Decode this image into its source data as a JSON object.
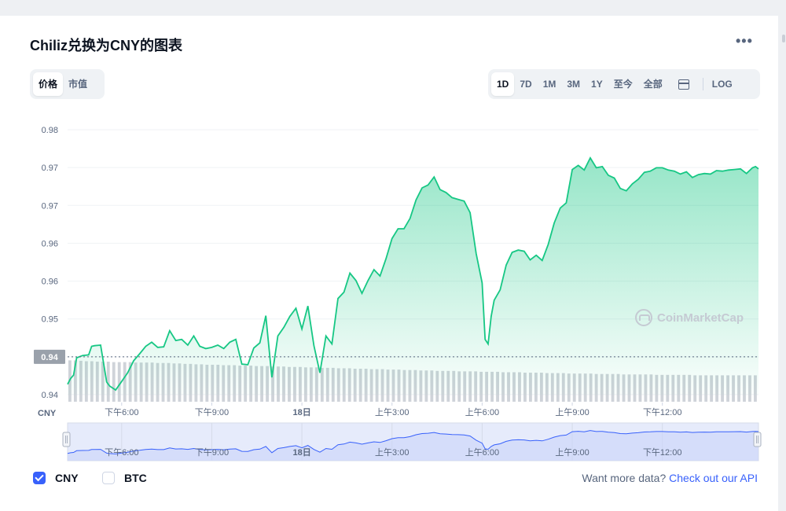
{
  "title": "Chiliz兑换为CNY的图表",
  "more_icon": "more-horizontal-icon",
  "left_toggle": {
    "items": [
      "价格",
      "市值"
    ],
    "selected": "价格"
  },
  "range_toggle": {
    "items": [
      "1D",
      "7D",
      "1M",
      "3M",
      "1Y",
      "至今",
      "全部"
    ],
    "selected": "1D",
    "calendar_icon": "calendar-icon",
    "log_label": "LOG"
  },
  "watermark": "CoinMarketCap",
  "colors": {
    "line": "#16c784",
    "accent": "#3861fb",
    "volume": "#cfd3d9",
    "navigator_line": "#3861fb"
  },
  "legend": [
    {
      "label": "CNY",
      "checked": true
    },
    {
      "label": "BTC",
      "checked": false
    }
  ],
  "footer": {
    "text": "Want more data?",
    "link": "Check out our API"
  },
  "chart_data": {
    "type": "area",
    "currency_label": "CNY",
    "y_tick_labels": [
      "0.98",
      "0.97",
      "0.97",
      "0.96",
      "0.96",
      "0.95",
      "0.94",
      "0.94"
    ],
    "ylim": [
      0.9364,
      0.9824
    ],
    "current_value_label": "0.94",
    "x_tick_labels": [
      "下午6:00",
      "下午9:00",
      "18日",
      "上午3:00",
      "上午6:00",
      "上午9:00",
      "下午12:00"
    ],
    "x_ticks_hours": [
      6,
      9,
      12,
      15,
      18,
      21,
      24
    ],
    "xlim_hours": [
      4.2,
      27.2
    ],
    "grid": true,
    "series": [
      {
        "x": [
          4.2,
          4.3,
          4.4,
          4.5,
          4.7,
          4.9,
          5.0,
          5.1,
          5.3,
          5.5,
          5.6,
          5.8,
          6.0,
          6.2,
          6.4,
          6.6,
          6.8,
          7.0,
          7.2,
          7.4,
          7.6,
          7.8,
          8.0,
          8.2,
          8.4,
          8.6,
          8.8,
          9.0,
          9.2,
          9.4,
          9.6,
          9.8,
          10.0,
          10.2,
          10.4,
          10.6,
          10.8,
          11.0,
          11.2,
          11.4,
          11.6,
          11.8,
          12.0,
          12.2,
          12.4,
          12.6,
          12.8,
          13.0,
          13.2,
          13.4,
          13.6,
          13.8,
          14.0,
          14.2,
          14.4,
          14.6,
          14.8,
          15.0,
          15.2,
          15.4,
          15.6,
          15.8,
          16.0,
          16.2,
          16.4,
          16.6,
          16.8,
          17.0,
          17.2,
          17.4,
          17.6,
          17.8,
          18.0,
          18.1,
          18.2,
          18.3,
          18.4,
          18.6,
          18.8,
          19.0,
          19.2,
          19.4,
          19.6,
          19.8,
          20.0,
          20.2,
          20.4,
          20.6,
          20.8,
          21.0,
          21.2,
          21.4,
          21.6,
          21.8,
          22.0,
          22.2,
          22.4,
          22.6,
          22.8,
          23.0,
          23.2,
          23.4,
          23.6,
          23.8,
          24.0,
          24.2,
          24.4,
          24.6,
          24.8,
          25.0,
          25.2,
          25.4,
          25.6,
          25.8,
          26.0,
          26.2,
          26.4,
          26.6,
          26.8,
          27.0,
          27.1,
          27.2
        ],
        "y": [
          0.9382,
          0.9392,
          0.9398,
          0.9428,
          0.9432,
          0.9433,
          0.9448,
          0.9449,
          0.945,
          0.9386,
          0.9379,
          0.9372,
          0.9387,
          0.9402,
          0.9423,
          0.9435,
          0.9448,
          0.9455,
          0.9446,
          0.9447,
          0.9475,
          0.9458,
          0.946,
          0.945,
          0.9466,
          0.9448,
          0.9444,
          0.9446,
          0.945,
          0.9444,
          0.9455,
          0.946,
          0.9417,
          0.9416,
          0.9445,
          0.9454,
          0.9501,
          0.9394,
          0.9466,
          0.9481,
          0.95,
          0.9514,
          0.9478,
          0.9518,
          0.9449,
          0.9402,
          0.9466,
          0.9452,
          0.9531,
          0.9542,
          0.9575,
          0.9562,
          0.954,
          0.9562,
          0.9581,
          0.957,
          0.96,
          0.9635,
          0.9652,
          0.9652,
          0.967,
          0.9702,
          0.9723,
          0.9728,
          0.9742,
          0.972,
          0.9715,
          0.9706,
          0.9703,
          0.97,
          0.968,
          0.9609,
          0.9558,
          0.946,
          0.9452,
          0.95,
          0.9528,
          0.9546,
          0.9589,
          0.9611,
          0.9615,
          0.9613,
          0.9598,
          0.9606,
          0.9597,
          0.9625,
          0.9662,
          0.9688,
          0.9697,
          0.9755,
          0.9762,
          0.9754,
          0.9775,
          0.9758,
          0.976,
          0.9745,
          0.974,
          0.9722,
          0.9718,
          0.973,
          0.9738,
          0.975,
          0.9752,
          0.9758,
          0.9758,
          0.9754,
          0.9752,
          0.9747,
          0.9751,
          0.9741,
          0.9746,
          0.9748,
          0.9747,
          0.9753,
          0.9752,
          0.9754,
          0.9755,
          0.9756,
          0.9748,
          0.9758,
          0.976,
          0.9756
        ]
      }
    ],
    "volume_relative": [
      0.94,
      0.94,
      0.93,
      0.92,
      0.92,
      0.91,
      0.91,
      0.91,
      0.9,
      0.9,
      0.9,
      0.9,
      0.89,
      0.89,
      0.89,
      0.89,
      0.88,
      0.88,
      0.88,
      0.87,
      0.87,
      0.86,
      0.86,
      0.85,
      0.85,
      0.84,
      0.84,
      0.84,
      0.83,
      0.83,
      0.83,
      0.82,
      0.82,
      0.82,
      0.81,
      0.81,
      0.81,
      0.8,
      0.8,
      0.8,
      0.79,
      0.79,
      0.79,
      0.78,
      0.78,
      0.78,
      0.77,
      0.77,
      0.77,
      0.76,
      0.76,
      0.76,
      0.75,
      0.75,
      0.75,
      0.74,
      0.74,
      0.74,
      0.73,
      0.73,
      0.73,
      0.72,
      0.72,
      0.72,
      0.71,
      0.71,
      0.71,
      0.7,
      0.7,
      0.7,
      0.7,
      0.69,
      0.69,
      0.69,
      0.69,
      0.68,
      0.68,
      0.68,
      0.68,
      0.67,
      0.67,
      0.67,
      0.67,
      0.66,
      0.66,
      0.66,
      0.66,
      0.65,
      0.65,
      0.65,
      0.65,
      0.64,
      0.64,
      0.64,
      0.64,
      0.64,
      0.63,
      0.63,
      0.63,
      0.63,
      0.63,
      0.62,
      0.62,
      0.62,
      0.62,
      0.62,
      0.62,
      0.61,
      0.61,
      0.61,
      0.61,
      0.61,
      0.61,
      0.61,
      0.6,
      0.6,
      0.6,
      0.6,
      0.6,
      0.6,
      0.6,
      0.6,
      0.6,
      0.6,
      0.6,
      0.6
    ]
  }
}
